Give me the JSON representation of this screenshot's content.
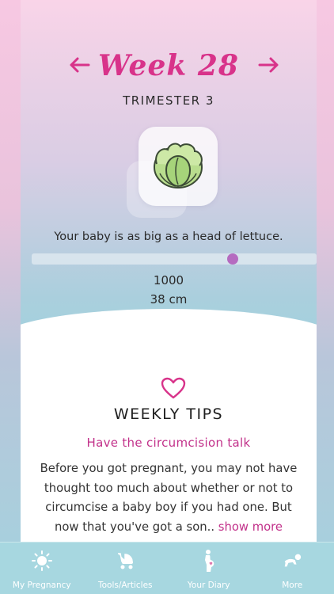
{
  "header": {
    "week_title": "Week 28",
    "trimester": "TRIMESTER 3",
    "prev_icon": "arrow-left-icon",
    "next_icon": "arrow-right-icon"
  },
  "baby_size": {
    "icon": "lettuce-icon",
    "text": "Your baby is as big as a head of lettuce.",
    "progress": 0.705,
    "weight": "1000",
    "length": "38 cm"
  },
  "tips": {
    "icon": "heart-icon",
    "heading": "WEEKLY TIPS",
    "title": "Have the circumcision talk",
    "body": "Before you got pregnant, you may not have thought too much about whether or not to circumcise a baby boy if you had one. But now that you've got a son..",
    "show_more": "show more"
  },
  "tabbar": {
    "items": [
      {
        "label": "My Pregnancy",
        "icon": "sun-icon"
      },
      {
        "label": "Tools/Articles",
        "icon": "stroller-icon"
      },
      {
        "label": "Your Diary",
        "icon": "pregnant-woman-icon"
      },
      {
        "label": "More",
        "icon": "crawling-baby-icon"
      }
    ]
  },
  "colors": {
    "accent": "#d8338a",
    "slider_thumb": "#b56bc0",
    "tabbar_bg": "#a7d7e0"
  }
}
